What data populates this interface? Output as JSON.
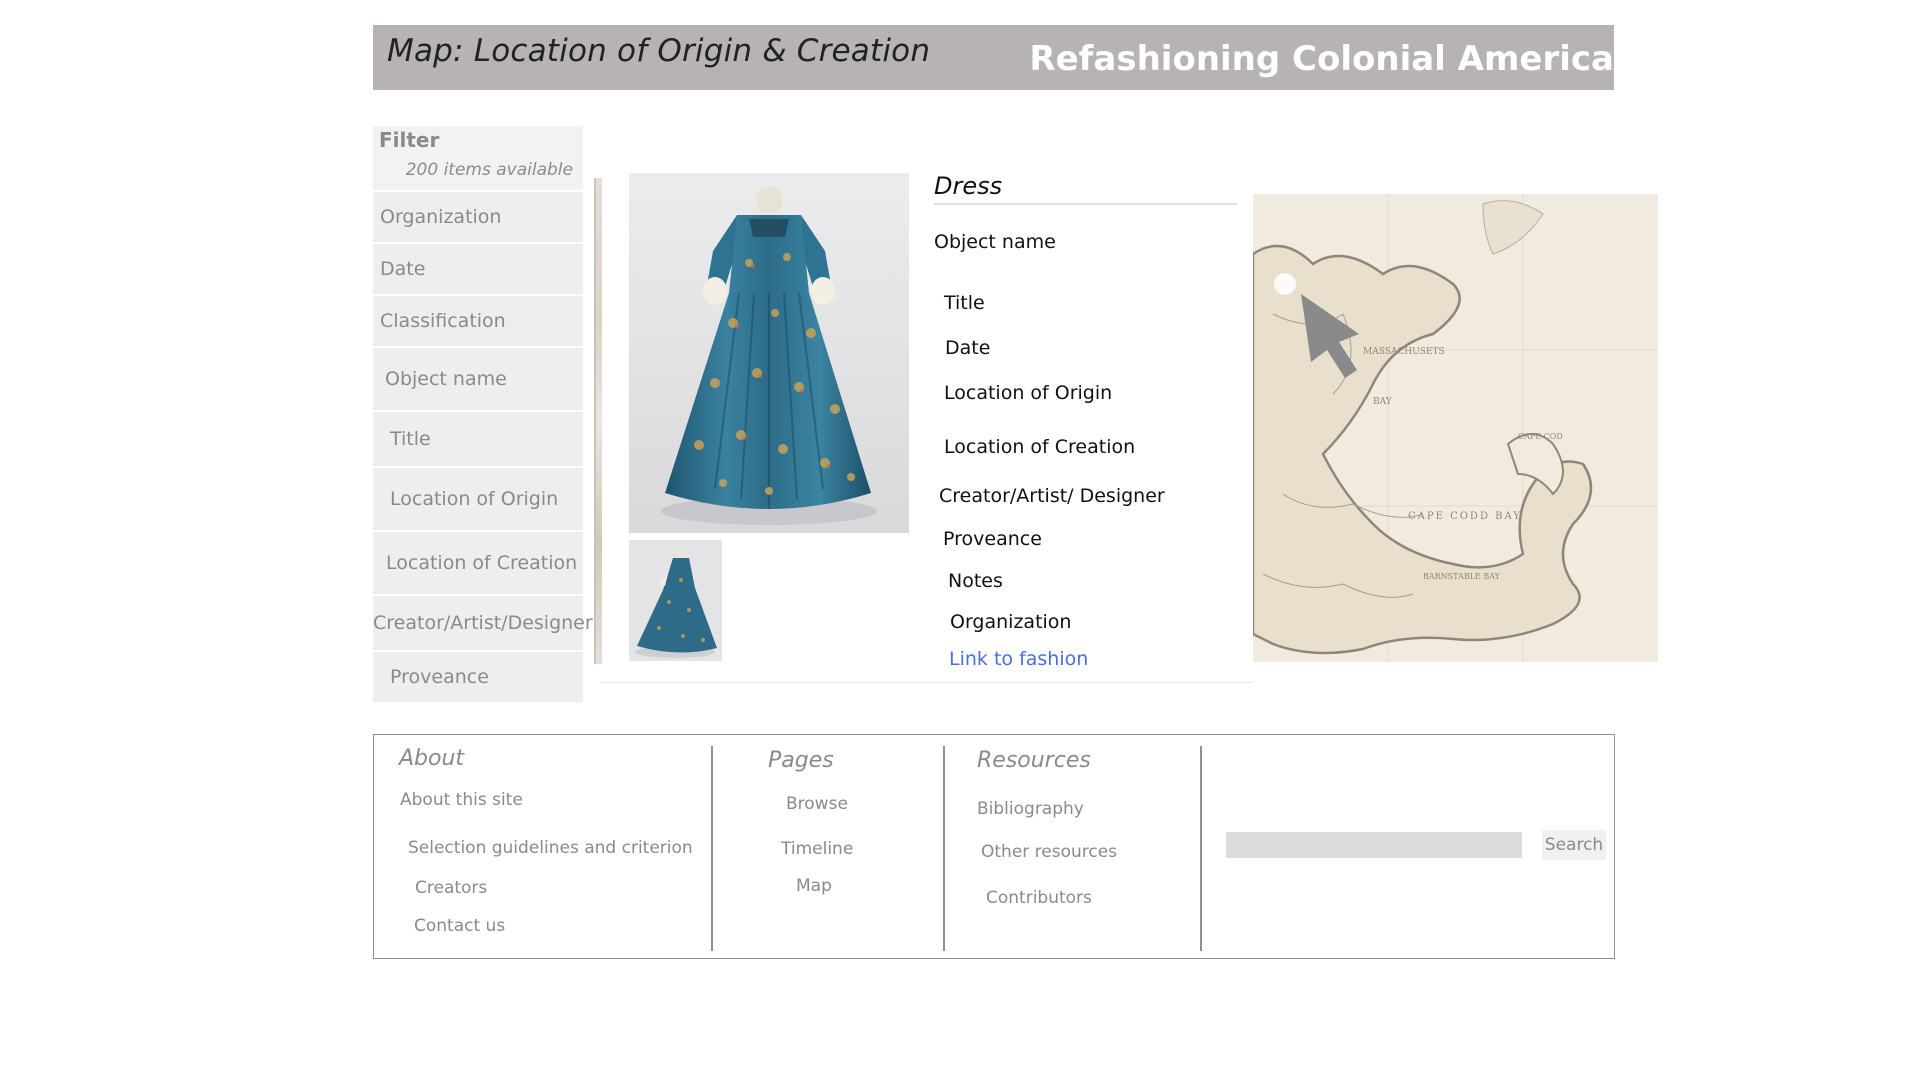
{
  "header": {
    "page_title": "Map: Location of Origin & Creation",
    "site_title": "Refashioning Colonial America"
  },
  "filter": {
    "heading": "Filter",
    "count": "200 items available",
    "items": [
      "Organization",
      "Date",
      "Classification",
      "Object name",
      "Title",
      "Location of Origin",
      "Location of Creation",
      "Creator/Artist/Designer",
      "Proveance"
    ]
  },
  "detail": {
    "title": "Dress",
    "fields": [
      "Object name",
      "Title",
      "Date",
      "Location of Origin",
      "Location of Creation",
      "Creator/Artist/ Designer",
      "Proveance",
      "Notes",
      "Organization"
    ],
    "link": "Link to fashion"
  },
  "map": {
    "labels": [
      "MASSACHUSETS",
      "BAY",
      "CAPE CODD BAY",
      "BARNSTABLE BAY",
      "CAPE COD"
    ]
  },
  "footer": {
    "about": {
      "heading": "About",
      "links": [
        "About this site",
        "Selection guidelines and criterion",
        "Creators",
        "Contact us"
      ]
    },
    "pages": {
      "heading": "Pages",
      "links": [
        "Browse",
        "Timeline",
        "Map"
      ]
    },
    "resources": {
      "heading": "Resources",
      "links": [
        "Bibliography",
        "Other resources",
        "Contributors"
      ]
    },
    "search": {
      "value": "",
      "button": "Search"
    }
  },
  "colors": {
    "header_bg": "#b6b3b2",
    "dress_blue": "#2f6f8c",
    "link": "#4a6ee0",
    "map_paper": "#f1ebdf"
  }
}
